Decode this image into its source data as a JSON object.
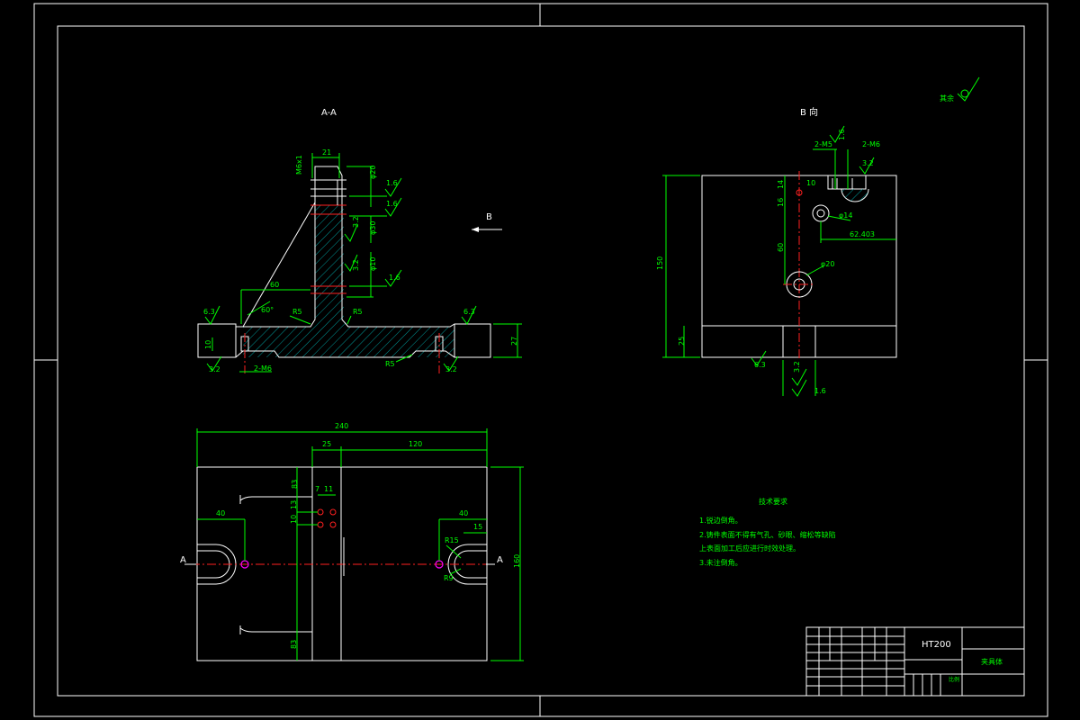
{
  "views": {
    "section_label": "A-A",
    "view_b_label": "B 向",
    "direction_arrow_label": "B",
    "section_mark_left": "A",
    "section_mark_right": "A"
  },
  "section_view": {
    "dims": {
      "top_width": "21",
      "thread": "M6x1",
      "left_60": "60",
      "angle": "60°",
      "r5_left": "R5",
      "r5_right": "R5",
      "r5_bottom": "R5",
      "height_27": "27",
      "dim_10": "10",
      "holes": "2-M6",
      "rough_63_left": "6.3",
      "rough_63_right": "6.3",
      "rough_32_left": "3.2",
      "rough_32_right": "3.2",
      "rough_16_a": "1.6",
      "rough_16_b": "1.6",
      "rough_16_c": "1.6",
      "rough_32_mid": "3.2",
      "rough_32_mid2": "3.2",
      "dia_a": "φ20",
      "dia_b": "φ30",
      "dia_c": "φ10"
    }
  },
  "plan_view": {
    "dims": {
      "overall": "240",
      "d25": "25",
      "d120": "120",
      "d40_left": "40",
      "d40_right": "40",
      "d15": "15",
      "r15": "R15",
      "r9": "R9",
      "d7": "7",
      "d11": "11",
      "d13": "13",
      "d10": "10",
      "d83_top": "83",
      "d83_bottom": "83",
      "d160": "160"
    }
  },
  "view_b": {
    "dims": {
      "holes_top": "2-M5",
      "holes_top_b": "2-M6",
      "rough_16": "1.6",
      "rough_32": "3.2",
      "d14": "14",
      "d16": "16",
      "d10": "10",
      "dia14": "φ14",
      "d62": "62.403",
      "d60": "60",
      "dia20": "φ20",
      "d150": "150",
      "d25": "25",
      "rough_63": "6.3",
      "rough_32b": "3.2",
      "rough_16b": "1.6"
    }
  },
  "roughness_note": "其余",
  "tech_requirements": {
    "title": "技术要求",
    "items": [
      "1.锐边倒角。",
      "2.铸件表面不得有气孔、砂眼、缩松等缺陷",
      "  上表面加工后应进行时效处理。",
      "3.未注倒角。"
    ]
  },
  "title_block": {
    "material": "HT200",
    "part_name": "夹具体",
    "scale_label": "比例"
  }
}
